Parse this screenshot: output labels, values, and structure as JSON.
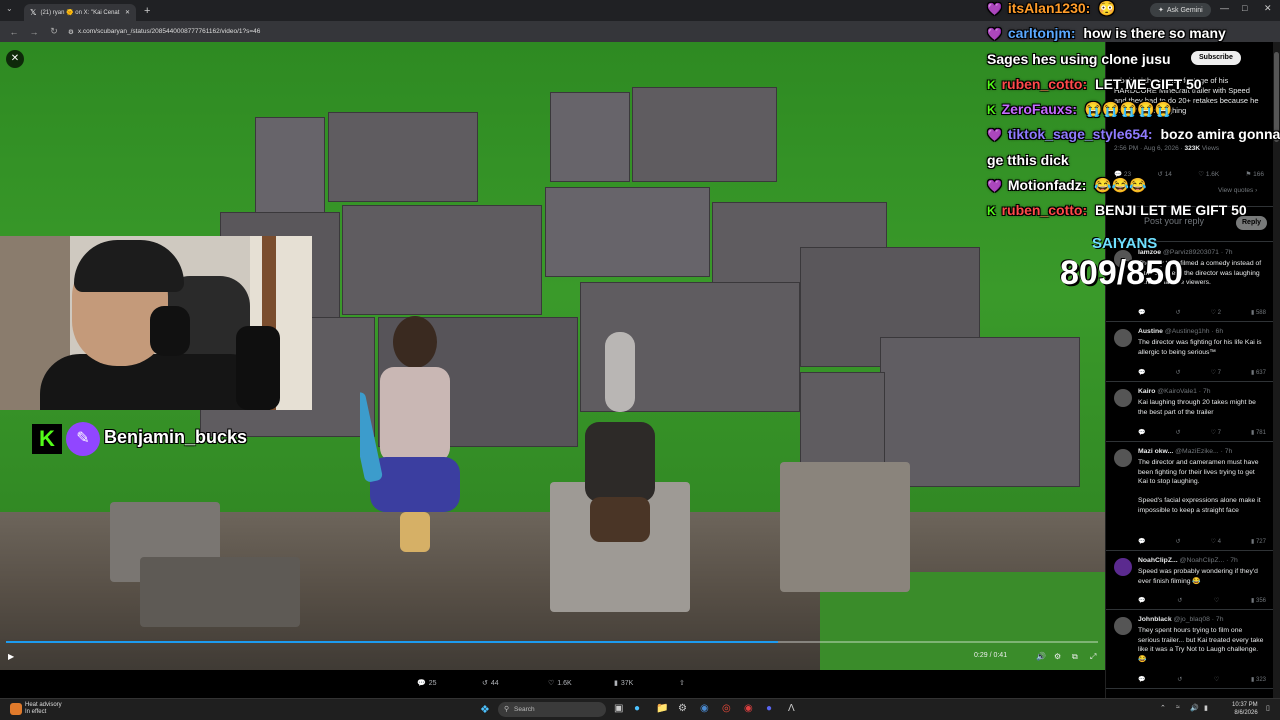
{
  "browser": {
    "tab_title": "(21) ryan 🌞 on X: \"Kai Cenat x",
    "ask_gemini": "Ask Gemini",
    "url": "x.com/scubaryan_/status/2085440008777761162/video/1?s=46"
  },
  "video": {
    "time": "0:29 / 0:41",
    "progress": 0.707
  },
  "stream_overlay": {
    "cam_name": "Benjamin_bucks",
    "goal_label": "SAIYANS",
    "goal_value": "809/850"
  },
  "chat": [
    {
      "user": "itsAlan1230:",
      "user_color": "#ff9c2a",
      "message": "😳"
    },
    {
      "user": "carltonjm:",
      "user_color": "#5aa8ff",
      "message": "how is there so many"
    },
    {
      "user": "",
      "user_color": "#ffffff",
      "message": "Sages hes using clone jusu"
    },
    {
      "user": "ruben_cotto:",
      "user_color": "#ff4a4a",
      "message": "LET ME GIFT 50"
    },
    {
      "user": "ZeroFauxs:",
      "user_color": "#c46bff",
      "message": "😭😭😭😭😭"
    },
    {
      "user": "tiktok_sage_style654:",
      "user_color": "#8f7bff",
      "message": "bozo amira gonna"
    },
    {
      "user": "",
      "user_color": "#ffffff",
      "message": "ge tthis dick"
    },
    {
      "user": "Motionfadz:",
      "user_color": "#ffffff",
      "message": "😂😂😂"
    },
    {
      "user": "ruben_cotto:",
      "user_color": "#ff4a4a",
      "message": "BENJI LET ME GIFT 50"
    }
  ],
  "panel": {
    "subscribe": "Subscribe",
    "tweet_text": "...behind the scenes footage of his HARDCORE Minecraft trailer with Speed and they had to do 20+ retakes because he couldn't stop laughing",
    "tweet_meta": "2:56 PM · Aug 6, 2026 ·",
    "tweet_views": "323K",
    "tweet_views_label": "Views",
    "tweet_stats": [
      "23",
      "14",
      "1.6K",
      "166"
    ],
    "view_quotes": "View quotes ›",
    "reply_placeholder": "Post your reply",
    "reply_button": "Reply",
    "comments": [
      {
        "name": "lamzoe",
        "handle": "@Parviz89203071 · 7h",
        "text": "The way they filmed a comedy instead of a trailer, guess the director was laughing harder than the viewers.",
        "stats": [
          "",
          "",
          "2",
          "588"
        ]
      },
      {
        "name": "Austine",
        "handle": "@Austineg1hh · 6h",
        "text": "The director was fighting for his life Kai is allergic to being serious™",
        "stats": [
          "",
          "",
          "7",
          "637"
        ]
      },
      {
        "name": "Kairo",
        "handle": "@KairoVale1 · 7h",
        "text": "Kai laughing through 20 takes might be the best part of the trailer",
        "stats": [
          "",
          "",
          "7",
          "781"
        ]
      },
      {
        "name": "Mazi okw...",
        "handle": "@MaziEzike... · 7h",
        "text": "The director and cameramen must have been fighting for their lives trying to get Kai to stop laughing.\n\nSpeed's facial expressions alone make it impossible to keep a straight face",
        "stats": [
          "",
          "",
          "4",
          "727"
        ]
      },
      {
        "name": "NoahClipZ...",
        "handle": "@NoahClipZ... · 7h",
        "text": "Speed was probably wondering if they'd ever finish filming 😂",
        "stats": [
          "",
          "",
          "",
          "356"
        ]
      },
      {
        "name": "Johnblack",
        "handle": "@jo_blaq08 · 7h",
        "text": "They spent hours trying to film one serious trailer... but Kai treated every take like it was a Try Not to Laugh challenge. 😂",
        "stats": [
          "",
          "",
          "",
          "323"
        ]
      }
    ]
  },
  "tweet_actions": {
    "replies": "25",
    "reposts": "44",
    "likes": "1.6K",
    "views": "37K"
  },
  "taskbar": {
    "weather_line1": "Heat advisory",
    "weather_line2": "In effect",
    "search": "Search",
    "time": "10:37 PM",
    "date": "8/6/2026"
  }
}
